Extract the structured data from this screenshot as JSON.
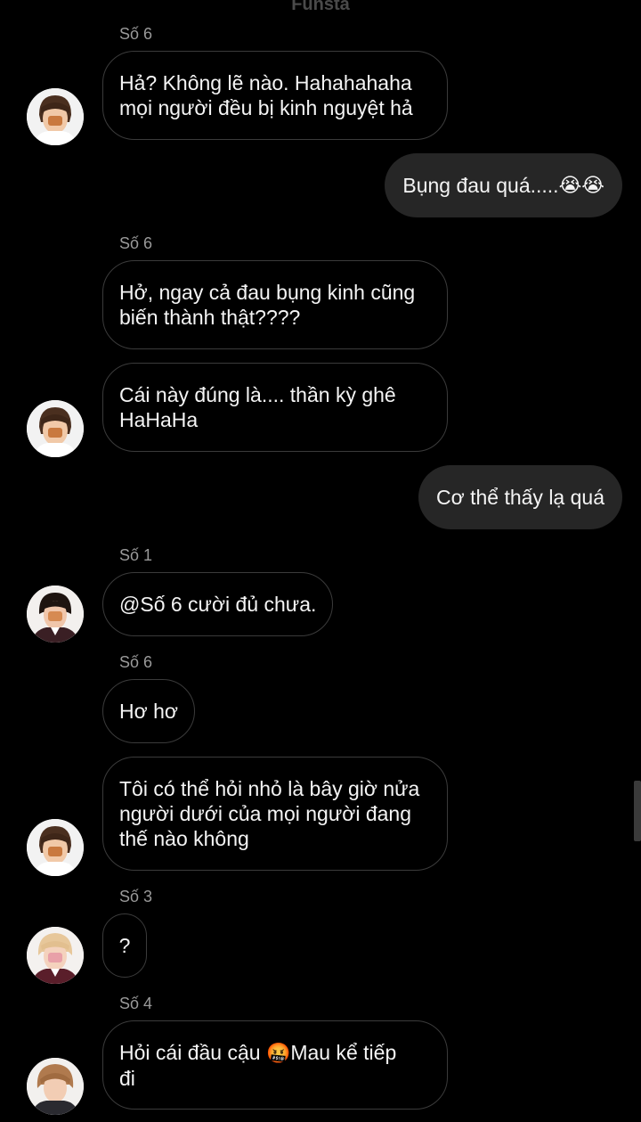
{
  "header": {
    "title": "Funsta"
  },
  "messages": {
    "m1": {
      "sender": "Số 6",
      "lines": [
        "Hả? Không lẽ nào. Hahahahaha",
        "mọi người đều bị kinh nguyệt hả"
      ]
    },
    "m2": {
      "text": "Bụng đau quá.....",
      "emoji": "😭😭"
    },
    "m3": {
      "sender": "Số 6",
      "lines": [
        "Hở, ngay cả đau bụng kinh cũng",
        "biến thành thật????"
      ]
    },
    "m4": {
      "lines": [
        "Cái này đúng là.... thần kỳ ghê",
        "HaHaHa"
      ]
    },
    "m5": {
      "text": "Cơ thể thấy lạ quá"
    },
    "m6": {
      "sender": "Số 1",
      "text": "@Số 6 cười đủ chưa."
    },
    "m7": {
      "sender": "Số 6",
      "text": "Hơ hơ"
    },
    "m8": {
      "lines": [
        "Tôi có thể hỏi nhỏ là bây giờ nửa",
        "người dưới của mọi người đang",
        "thế nào không"
      ]
    },
    "m9": {
      "sender": "Số 3",
      "text": "?"
    },
    "m10": {
      "sender": "Số 4",
      "line1_before": "Hỏi cái đầu cậu ",
      "emoji": "🤬",
      "line1_after": "Mau kể tiếp",
      "line2": "đi"
    }
  },
  "colors": {
    "background": "#000000",
    "incoming_border": "#3b3b3b",
    "outgoing_bg": "#262626",
    "sender_text": "#9a9a9a"
  }
}
